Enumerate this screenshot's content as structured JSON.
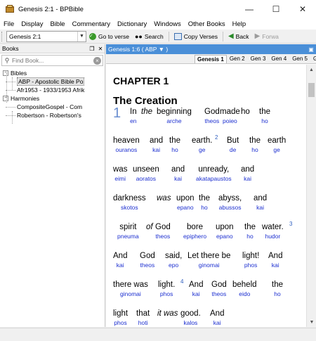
{
  "window": {
    "title": "Genesis 2:1 - BPBible"
  },
  "menu": [
    "File",
    "Display",
    "Bible",
    "Commentary",
    "Dictionary",
    "Windows",
    "Other Books",
    "Help"
  ],
  "toolbar": {
    "reference": "Genesis 2:1",
    "go_label": "Go to verse",
    "search_label": "Search",
    "copy_label": "Copy Verses",
    "back_label": "Back",
    "forward_label": "Forwa"
  },
  "books_pane": {
    "title": "Books",
    "find_placeholder": "Find Book...",
    "tree": {
      "bibles_label": "Bibles",
      "bibles": [
        "ABP - Apostolic Bible Po",
        "Afr1953 - 1933/1953 Afrik"
      ],
      "harmonies_label": "Harmonies",
      "harmonies": [
        "CompositeGospel - Com",
        "Robertson - Robertson's"
      ]
    }
  },
  "bible_pane": {
    "header": "Genesis 1:6 ( ABP ▼ )",
    "tabs": [
      "Genesis 1",
      "Gen 2",
      "Gen 3",
      "Gen 4",
      "Gen 5",
      "G"
    ],
    "chapter": "CHAPTER 1",
    "section": "The Creation",
    "verse_number_big": "1",
    "verse_2": "2",
    "verse_3": "3",
    "verse_4": "4",
    "lines": [
      [
        [
          "In",
          "en"
        ],
        [
          "the",
          "",
          true
        ],
        [
          "beginning",
          "arche"
        ],
        [
          "God",
          "theos"
        ],
        [
          "made",
          "poieo"
        ],
        [
          "ho",
          ""
        ],
        [
          "the",
          "ho"
        ]
      ],
      [
        [
          "heaven",
          "ouranos"
        ],
        [
          "and",
          "kai"
        ],
        [
          "the",
          "ho"
        ],
        [
          "earth.",
          "ge"
        ],
        [
          "But",
          "de"
        ],
        [
          "the",
          "ho"
        ],
        [
          "earth",
          "ge"
        ]
      ],
      [
        [
          "was",
          "eimi"
        ],
        [
          "unseen",
          "aoratos"
        ],
        [
          "and",
          "kai"
        ],
        [
          "unready,",
          "akatapaustos"
        ],
        [
          "and",
          "kai"
        ]
      ],
      [
        [
          "darkness",
          "skotos"
        ],
        [
          "was",
          "",
          true
        ],
        [
          "upon",
          "epano"
        ],
        [
          "the",
          "ho"
        ],
        [
          "abyss,",
          "abussos"
        ],
        [
          "and",
          "kai"
        ]
      ],
      [
        [
          "spirit",
          "pneuma"
        ],
        [
          "of",
          "",
          true
        ],
        [
          "God",
          "theos"
        ],
        [
          "bore",
          "epiphero"
        ],
        [
          "upon",
          "epano"
        ],
        [
          "the",
          "ho"
        ],
        [
          "water.",
          "hudor"
        ]
      ],
      [
        [
          "And",
          "kai"
        ],
        [
          "God",
          "theos"
        ],
        [
          "said,",
          "epo"
        ],
        [
          "Let there be",
          "ginomai"
        ],
        [
          "light!",
          "phos"
        ],
        [
          "And",
          "kai"
        ]
      ],
      [
        [
          "there was",
          "ginomai"
        ],
        [
          "light.",
          "phos"
        ],
        [
          "And",
          "kai"
        ],
        [
          "God",
          "theos"
        ],
        [
          "beheld",
          "eido"
        ],
        [
          "the",
          "ho"
        ]
      ],
      [
        [
          "light",
          "phos"
        ],
        [
          "that",
          "hoti"
        ],
        [
          "it was",
          "",
          true
        ],
        [
          "good.",
          "kalos"
        ],
        [
          "And",
          "kai"
        ]
      ]
    ]
  }
}
